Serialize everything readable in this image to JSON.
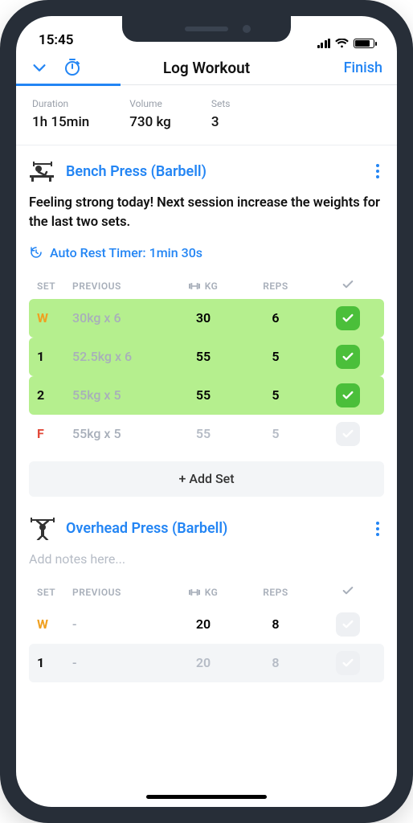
{
  "status": {
    "time": "15:45"
  },
  "nav": {
    "title": "Log Workout",
    "finish": "Finish"
  },
  "stats": {
    "duration_label": "Duration",
    "duration_value": "1h 15min",
    "volume_label": "Volume",
    "volume_value": "730 kg",
    "sets_label": "Sets",
    "sets_value": "3"
  },
  "exercises": [
    {
      "name": "Bench Press (Barbell)",
      "note": "Feeling strong today! Next session increase the weights for the last two sets.",
      "timer": "Auto Rest Timer: 1min 30s",
      "headers": {
        "set": "SET",
        "prev": "PREVIOUS",
        "kg": "KG",
        "reps": "REPS"
      },
      "sets": [
        {
          "tag": "W",
          "tagClass": "set-w",
          "prev": "30kg x 6",
          "kg": "30",
          "reps": "6",
          "done": true
        },
        {
          "tag": "1",
          "tagClass": "set-n",
          "prev": "52.5kg x 6",
          "kg": "55",
          "reps": "5",
          "done": true
        },
        {
          "tag": "2",
          "tagClass": "set-n",
          "prev": "55kg x 5",
          "kg": "55",
          "reps": "5",
          "done": true
        },
        {
          "tag": "F",
          "tagClass": "set-f",
          "prev": "55kg x 5",
          "kg": "55",
          "reps": "5",
          "done": false
        }
      ],
      "add_set": "+ Add Set"
    },
    {
      "name": "Overhead Press (Barbell)",
      "placeholder": "Add notes here...",
      "headers": {
        "set": "SET",
        "prev": "PREVIOUS",
        "kg": "KG",
        "reps": "REPS"
      },
      "sets": [
        {
          "tag": "W",
          "tagClass": "set-w",
          "prev": "-",
          "kg": "20",
          "reps": "8",
          "done": false
        },
        {
          "tag": "1",
          "tagClass": "set-n",
          "prev": "-",
          "kg": "20",
          "reps": "8",
          "done": false,
          "grey": true
        }
      ]
    }
  ]
}
